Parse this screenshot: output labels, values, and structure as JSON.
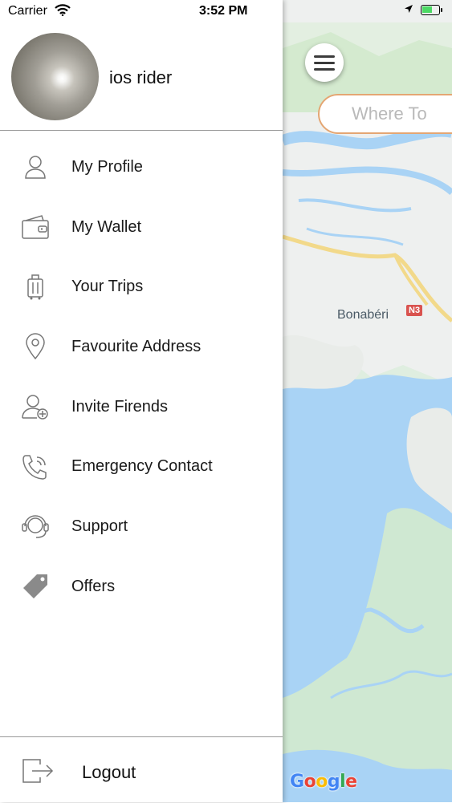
{
  "status_bar": {
    "carrier": "Carrier",
    "time": "3:52 PM"
  },
  "drawer": {
    "user_name": "ios rider",
    "menu_items": [
      {
        "label": "My Profile",
        "icon": "person-icon"
      },
      {
        "label": "My Wallet",
        "icon": "wallet-icon"
      },
      {
        "label": "Your Trips",
        "icon": "luggage-icon"
      },
      {
        "label": "Favourite Address",
        "icon": "location-pin-icon"
      },
      {
        "label": "Invite Firends",
        "icon": "add-user-icon"
      },
      {
        "label": "Emergency Contact",
        "icon": "phone-call-icon"
      },
      {
        "label": "Support",
        "icon": "headset-icon"
      },
      {
        "label": "Offers",
        "icon": "tag-icon"
      }
    ],
    "logout_label": "Logout"
  },
  "map": {
    "search_placeholder": "Where To",
    "place_label": "Bonabéri",
    "road_badge": "N3",
    "attribution": "Google",
    "colors": {
      "land": "#eef0ef",
      "water": "#a9d3f5",
      "park": "#cfe8d2",
      "road": "#f2d98a",
      "accent": "#e4a673"
    }
  }
}
